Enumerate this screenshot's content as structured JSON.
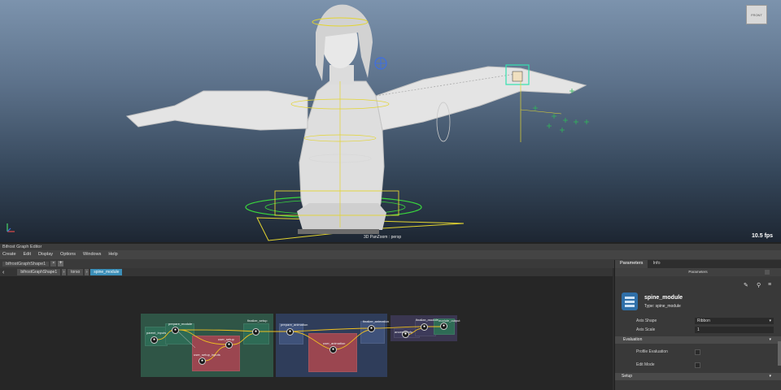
{
  "viewport": {
    "camera_label": "3D PanZoom : persp",
    "fps": "10.5 fps",
    "viewcube_label": "FRONT"
  },
  "node_editor": {
    "title": "Bifrost Graph Editor",
    "menu": [
      "Create",
      "Edit",
      "Display",
      "Options",
      "Windows",
      "Help"
    ],
    "tab": "bifrostGraphShape1",
    "breadcrumb": [
      "bifrostGraphShape1",
      "torso",
      "spine_module"
    ],
    "nodes": {
      "prepare_module": "prepare_module",
      "parent_inputs": "parent_inputs",
      "finalize_setup": "finalize_setup",
      "user_setup": "user_setup",
      "user_setup_inputs": "user_setup_inputs",
      "prepare_animation": "prepare_animation",
      "finalize_animation": "finalize_animation",
      "user_animation": "user_animation",
      "finalize_module": "finalize_module",
      "module_output": "module_output",
      "ancestor_info": "ancestorInfo"
    }
  },
  "params": {
    "tabs": [
      "Parameters",
      "Info"
    ],
    "header": "Parameters",
    "node_name": "spine_module",
    "node_type": "Type: spine_module",
    "axis_shape_label": "Axis Shape",
    "axis_shape_value": "Ribbon",
    "axis_scale_label": "Axis Scale",
    "axis_scale_value": "1",
    "section_evaluation": "Evaluation",
    "profile_eval": "Profile Evaluation",
    "edit_mode": "Edit Mode",
    "section_setup": "Setup"
  },
  "colors": {
    "setup_backdrop": "#2f5546",
    "anim_backdrop": "#2f3d5a",
    "red_node": "#9b4650",
    "blue_node": "#3f527a",
    "teal_node": "#2e6b55",
    "accent_blue": "#3c8fb8"
  }
}
